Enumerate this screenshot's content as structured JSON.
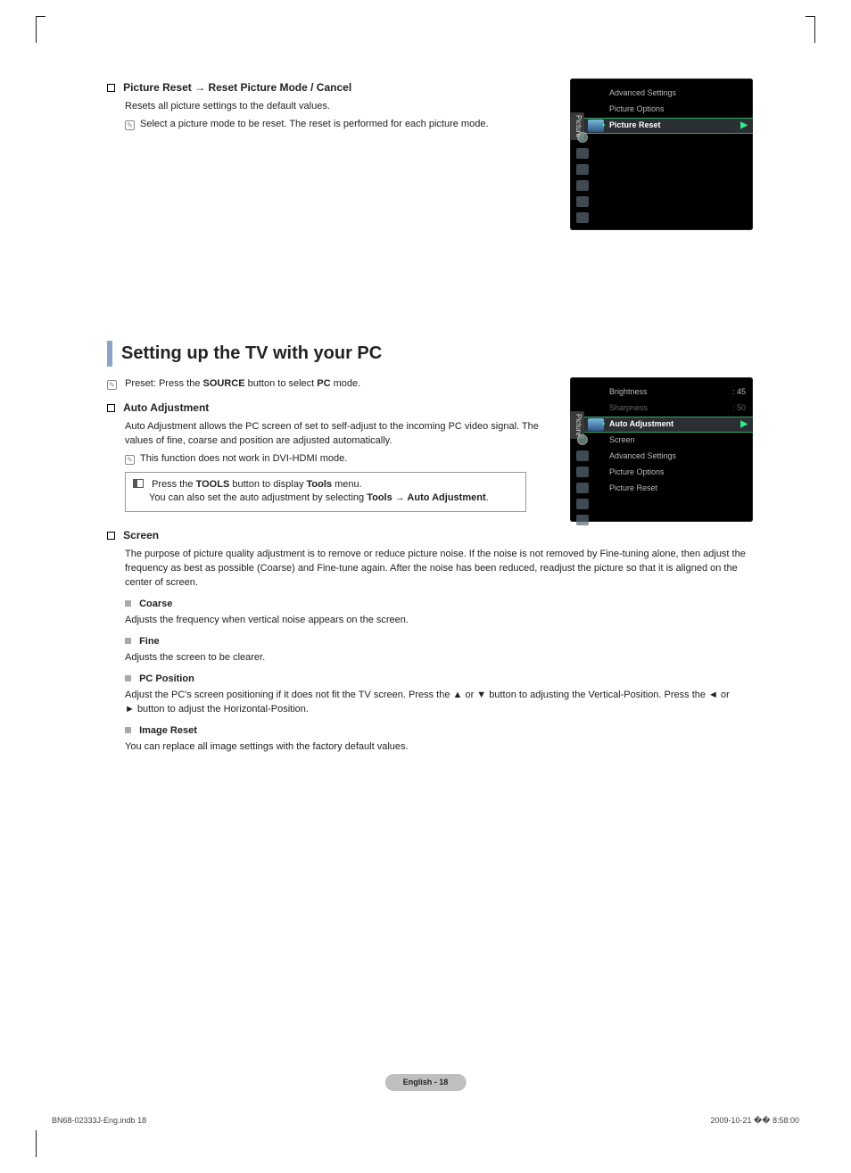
{
  "picture_reset": {
    "heading_prefix": "Picture Reset → ",
    "heading_rest": "Reset Picture Mode / Cancel",
    "desc": "Resets all picture settings to the default values.",
    "note": "Select a picture mode to be reset. The reset is performed for each picture mode."
  },
  "osd1": {
    "side_label": "Picture",
    "items": [
      {
        "label": "Advanced Settings",
        "dim": false
      },
      {
        "label": "Picture Options",
        "dim": false
      },
      {
        "label": "Picture Reset",
        "selected": true
      }
    ]
  },
  "setting_pc": {
    "title": "Setting up the TV with your PC",
    "preset_note_pre": "Preset: Press the ",
    "preset_note_bold1": "SOURCE",
    "preset_note_mid": " button to select ",
    "preset_note_bold2": "PC",
    "preset_note_end": " mode.",
    "auto_adj": {
      "title": "Auto Adjustment",
      "desc": "Auto Adjustment allows the PC screen of set to self-adjust to the incoming PC video signal. The values of fine, coarse and position are adjusted automatically.",
      "note": "This function does not work in DVI-HDMI mode.",
      "tip_line1_pre": "Press the ",
      "tip_line1_bold1": "TOOLS",
      "tip_line1_mid": " button to display ",
      "tip_line1_bold2": "Tools",
      "tip_line1_end": " menu.",
      "tip_line2_pre": "You can also set the auto adjustment by selecting ",
      "tip_line2_bold": "Tools → Auto Adjustment",
      "tip_line2_end": "."
    },
    "screen": {
      "title": "Screen",
      "desc": "The purpose of picture quality adjustment is to remove or reduce picture noise. If the noise is not removed by Fine-tuning alone, then adjust the frequency as best as possible (Coarse) and Fine-tune again. After the noise has been reduced, readjust the picture so that it is aligned on the center of screen.",
      "items": [
        {
          "title": "Coarse",
          "body": "Adjusts the frequency when vertical noise appears on the screen."
        },
        {
          "title": "Fine",
          "body": "Adjusts the screen to be clearer."
        },
        {
          "title": "PC Position",
          "body": "Adjust the PC's screen positioning if it does not fit the TV screen. Press the ▲ or ▼ button to adjusting the Vertical-Position. Press the ◄ or ► button to adjust the Horizontal-Position."
        },
        {
          "title": "Image Reset",
          "body": "You can replace all image settings with the factory default values."
        }
      ]
    }
  },
  "osd2": {
    "side_label": "Picture",
    "rows": [
      {
        "label": "Brightness",
        "val": ": 45",
        "dim": false
      },
      {
        "label": "Sharpness",
        "val": ": 50",
        "dim": true
      },
      {
        "label": "Auto Adjustment",
        "selected": true
      },
      {
        "label": "Screen"
      },
      {
        "label": "Advanced Settings"
      },
      {
        "label": "Picture Options"
      },
      {
        "label": "Picture Reset"
      }
    ]
  },
  "footer": {
    "page_label": "English - 18",
    "doc_info": "BN68-02333J-Eng.indb   18",
    "timestamp": "2009-10-21   �� 8:58:00"
  }
}
